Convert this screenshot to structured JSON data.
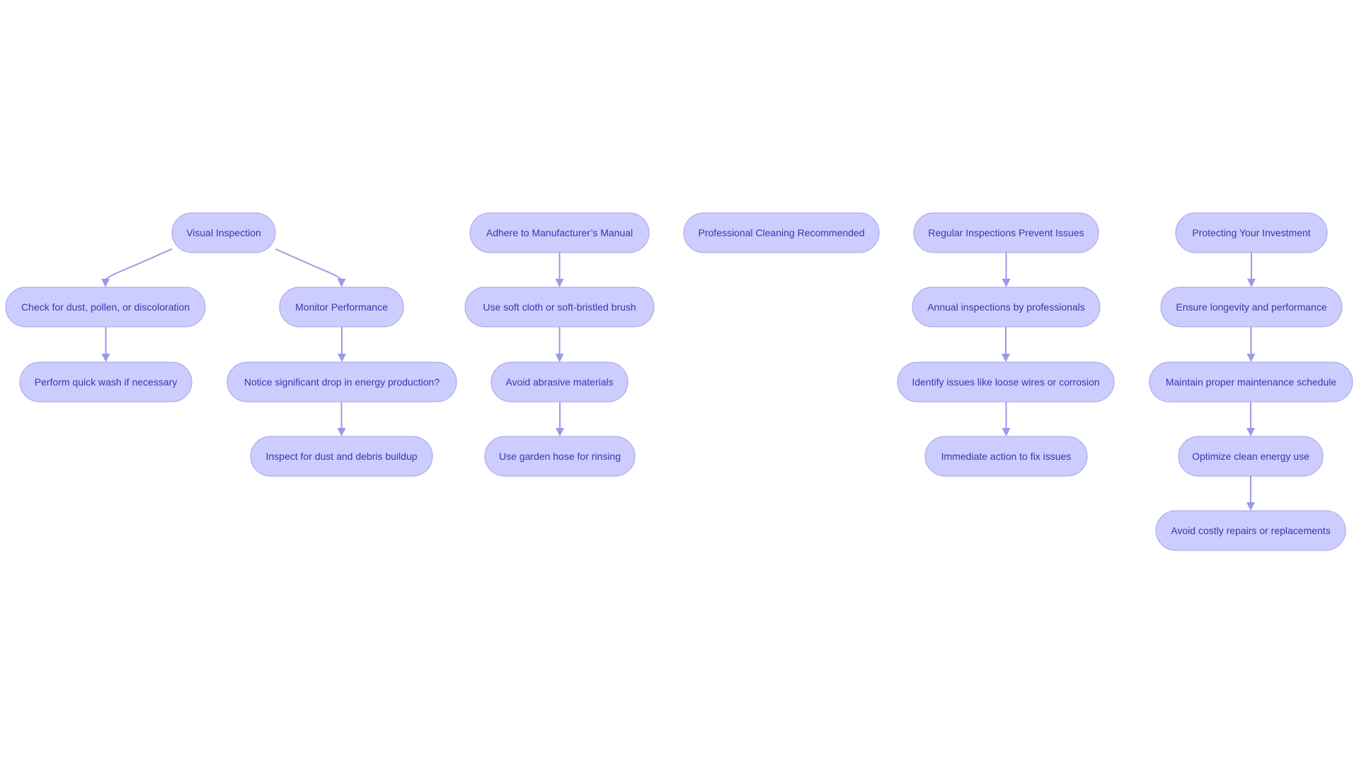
{
  "diagram": {
    "type": "flowchart",
    "direction": "top-down",
    "colors": {
      "node_fill": "#ccccff",
      "node_border": "#a3a3e6",
      "node_text": "#3636b0",
      "edge": "#9a9ae6",
      "background": "#ffffff"
    },
    "groups": [
      {
        "id": "visual-inspection",
        "nodes": [
          {
            "id": "n1",
            "label": "Visual Inspection"
          },
          {
            "id": "n2",
            "label": "Check for dust, pollen, or discoloration"
          },
          {
            "id": "n3",
            "label": "Perform quick wash if necessary"
          },
          {
            "id": "n4",
            "label": "Monitor Performance"
          },
          {
            "id": "n5",
            "label": "Notice significant drop in energy production?"
          },
          {
            "id": "n6",
            "label": "Inspect for dust and debris buildup"
          }
        ],
        "edges": [
          [
            "n1",
            "n2"
          ],
          [
            "n2",
            "n3"
          ],
          [
            "n1",
            "n4"
          ],
          [
            "n4",
            "n5"
          ],
          [
            "n5",
            "n6"
          ]
        ]
      },
      {
        "id": "manual",
        "nodes": [
          {
            "id": "n7",
            "label": "Adhere to Manufacturer’s Manual"
          },
          {
            "id": "n8",
            "label": "Use soft cloth or soft-bristled brush"
          },
          {
            "id": "n9",
            "label": "Avoid abrasive materials"
          },
          {
            "id": "n10",
            "label": "Use garden hose for rinsing"
          }
        ],
        "edges": [
          [
            "n7",
            "n8"
          ],
          [
            "n8",
            "n9"
          ],
          [
            "n9",
            "n10"
          ]
        ]
      },
      {
        "id": "professional",
        "nodes": [
          {
            "id": "n11",
            "label": "Professional Cleaning Recommended"
          }
        ],
        "edges": []
      },
      {
        "id": "regular",
        "nodes": [
          {
            "id": "n12",
            "label": "Regular Inspections Prevent Issues"
          },
          {
            "id": "n13",
            "label": "Annual inspections by professionals"
          },
          {
            "id": "n14",
            "label": "Identify issues like loose wires or corrosion"
          },
          {
            "id": "n15",
            "label": "Immediate action to fix issues"
          }
        ],
        "edges": [
          [
            "n12",
            "n13"
          ],
          [
            "n13",
            "n14"
          ],
          [
            "n14",
            "n15"
          ]
        ]
      },
      {
        "id": "investment",
        "nodes": [
          {
            "id": "n16",
            "label": "Protecting Your Investment"
          },
          {
            "id": "n17",
            "label": "Ensure longevity and performance"
          },
          {
            "id": "n18",
            "label": "Maintain proper maintenance schedule"
          },
          {
            "id": "n19",
            "label": "Optimize clean energy use"
          },
          {
            "id": "n20",
            "label": "Avoid costly repairs or replacements"
          }
        ],
        "edges": [
          [
            "n16",
            "n17"
          ],
          [
            "n17",
            "n18"
          ],
          [
            "n18",
            "n19"
          ],
          [
            "n19",
            "n20"
          ]
        ]
      }
    ]
  }
}
